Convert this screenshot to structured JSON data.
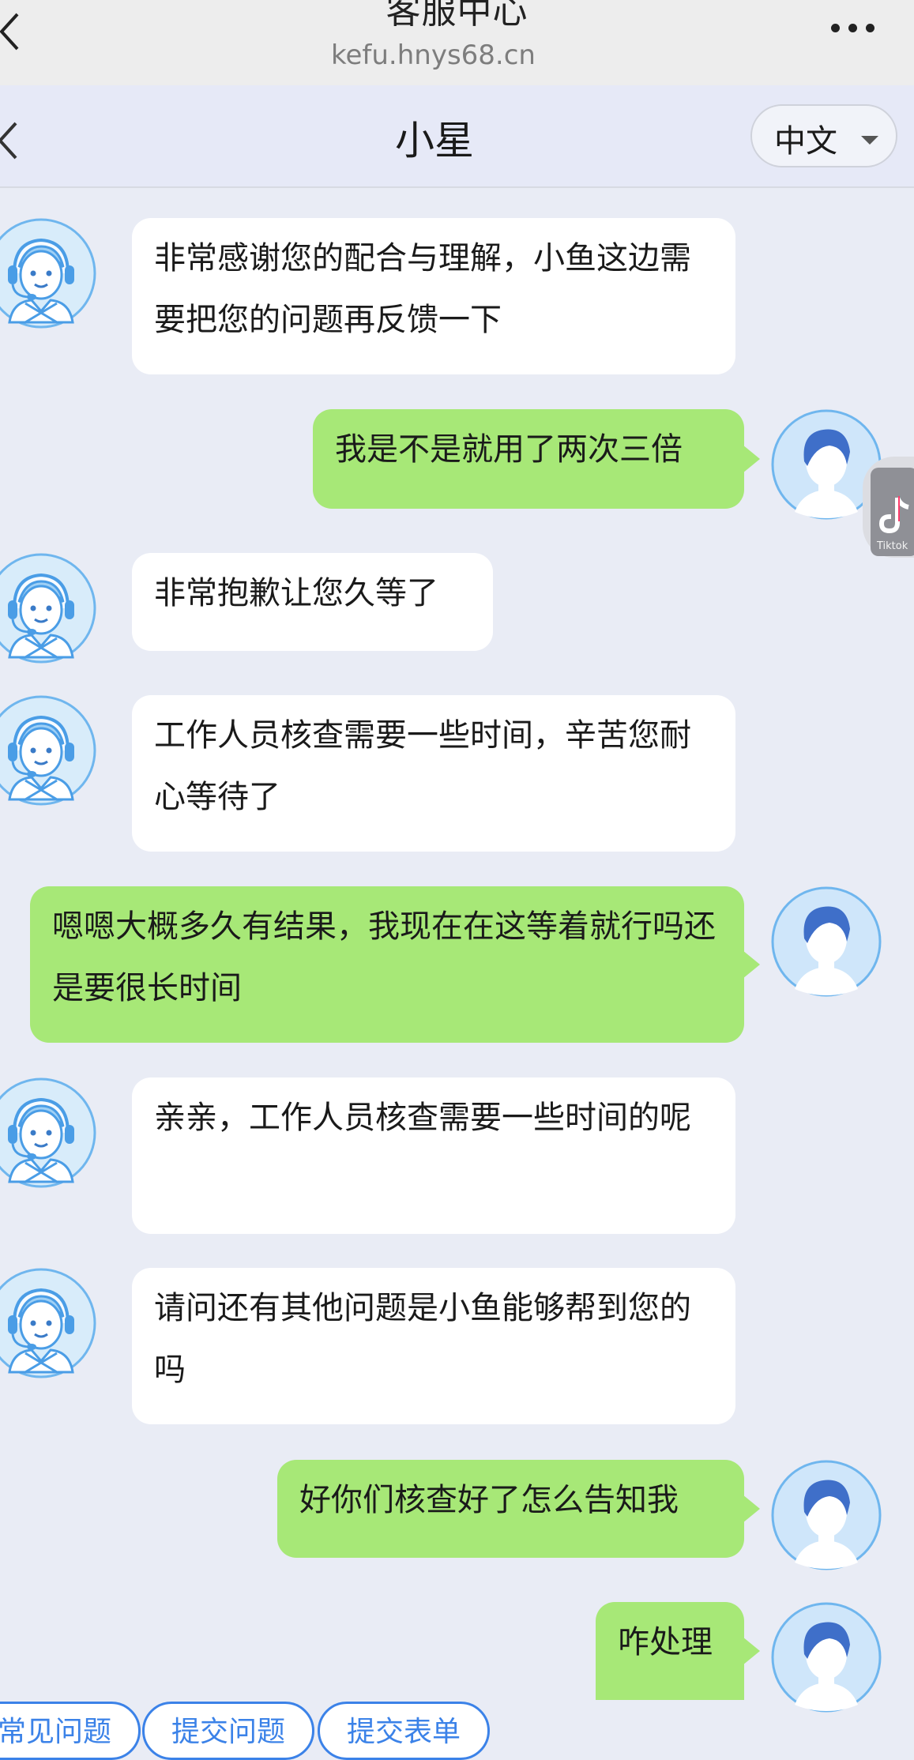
{
  "browser": {
    "title": "客服中心",
    "url": "kefu.hnys68.cn"
  },
  "chat": {
    "title": "小星",
    "language": "中文"
  },
  "messages": [
    {
      "sender": "agent",
      "text": "非常感谢您的配合与理解，小鱼这边需要把您的问题再反馈一下"
    },
    {
      "sender": "user",
      "text": "我是不是就用了两次三倍"
    },
    {
      "sender": "agent",
      "text": "非常抱歉让您久等了"
    },
    {
      "sender": "agent",
      "text": "工作人员核查需要一些时间，辛苦您耐心等待了"
    },
    {
      "sender": "user",
      "text": "嗯嗯大概多久有结果，我现在在这等着就行吗还是要很长时间"
    },
    {
      "sender": "agent",
      "text": "亲亲，工作人员核查需要一些时间的呢"
    },
    {
      "sender": "agent",
      "text": "请问还有其他问题是小鱼能够帮到您的吗"
    },
    {
      "sender": "user",
      "text": "好你们核查好了怎么告知我"
    },
    {
      "sender": "user",
      "text": "咋处理"
    }
  ],
  "floating_widget": {
    "icon": "tiktok-icon",
    "label": "Tiktok"
  },
  "quick_replies": [
    "常见问题",
    "提交问题",
    "提交表单"
  ],
  "colors": {
    "user_bubble": "#a7e877",
    "agent_bubble": "#ffffff",
    "chat_background": "#e9ecf5",
    "chip_accent": "#3b82e8"
  }
}
